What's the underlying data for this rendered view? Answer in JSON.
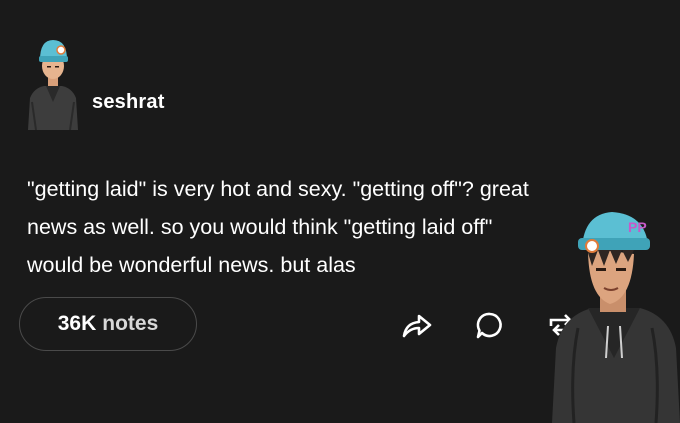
{
  "post": {
    "author": {
      "username": "seshrat",
      "avatar_icon": "user-avatar-icon"
    },
    "body_lines": [
      "\"getting laid\" is very hot and sexy. \"getting off\"? great",
      "news as well. so you would think \"getting laid off\"",
      "would be wonderful news. but alas"
    ],
    "notes": {
      "count": "36K",
      "label": "notes"
    },
    "actions": [
      {
        "name": "share",
        "icon": "share-arrow-icon"
      },
      {
        "name": "reply",
        "icon": "speech-bubble-icon"
      },
      {
        "name": "reblog",
        "icon": "reblog-arrows-icon"
      }
    ]
  },
  "colors": {
    "background": "#1a1a1a",
    "text": "#ffffff",
    "pill_border": "#4a4a4a",
    "beanie": "#5bbfd3"
  }
}
